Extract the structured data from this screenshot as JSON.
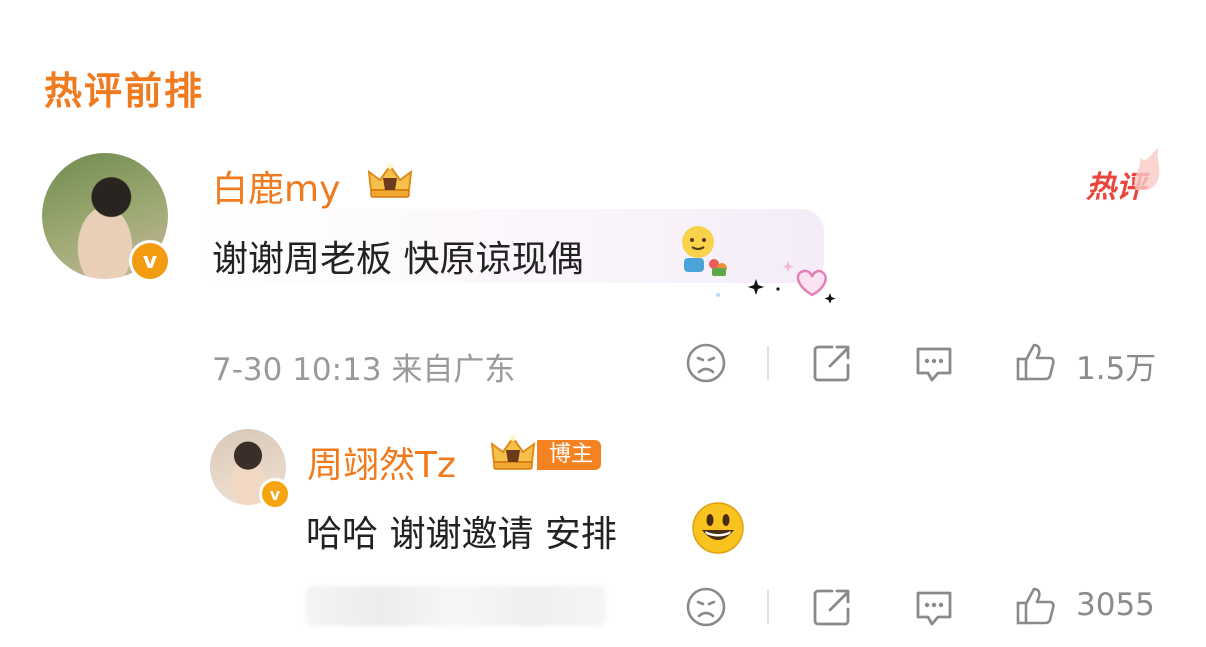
{
  "section": {
    "title": "热评前排"
  },
  "comment": {
    "username": "白鹿my",
    "text": "谢谢周老板 快原谅现偶",
    "hot_tag": "热评",
    "verified_mark": "v",
    "meta": "7-30 10:13 来自广东",
    "like_count": "1.5万"
  },
  "reply": {
    "username": "周翊然Tz",
    "author_tag": "博主",
    "text": "哈哈 谢谢邀请 安排",
    "verified_mark": "v",
    "like_count": "3055"
  },
  "icons": {
    "dislike": "sad-face-icon",
    "share": "share-icon",
    "comment": "comment-icon",
    "like": "thumbs-up-icon",
    "crown": "crown-badge-icon"
  },
  "colors": {
    "accent": "#f07a1e",
    "hot": "#e8453c",
    "text": "#222222",
    "meta": "#9a9a9a"
  }
}
